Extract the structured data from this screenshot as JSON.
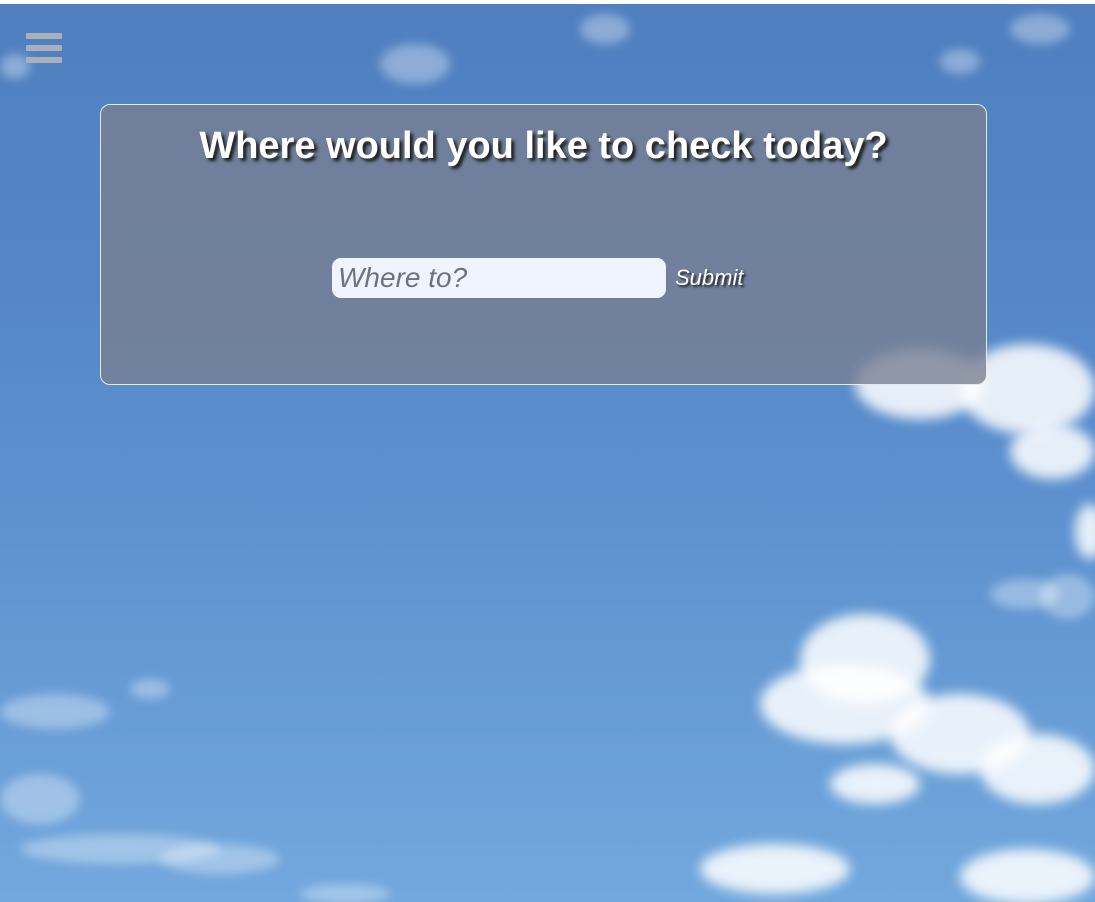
{
  "menu": {
    "icon": "hamburger-menu-icon"
  },
  "panel": {
    "title": "Where would you like to check today?"
  },
  "search": {
    "placeholder": "Where to?",
    "value": "",
    "submit_label": "Submit"
  },
  "colors": {
    "sky": "#5486c7",
    "panel": "#78809288",
    "input": "#eef5ff",
    "text": "#ffffff"
  }
}
